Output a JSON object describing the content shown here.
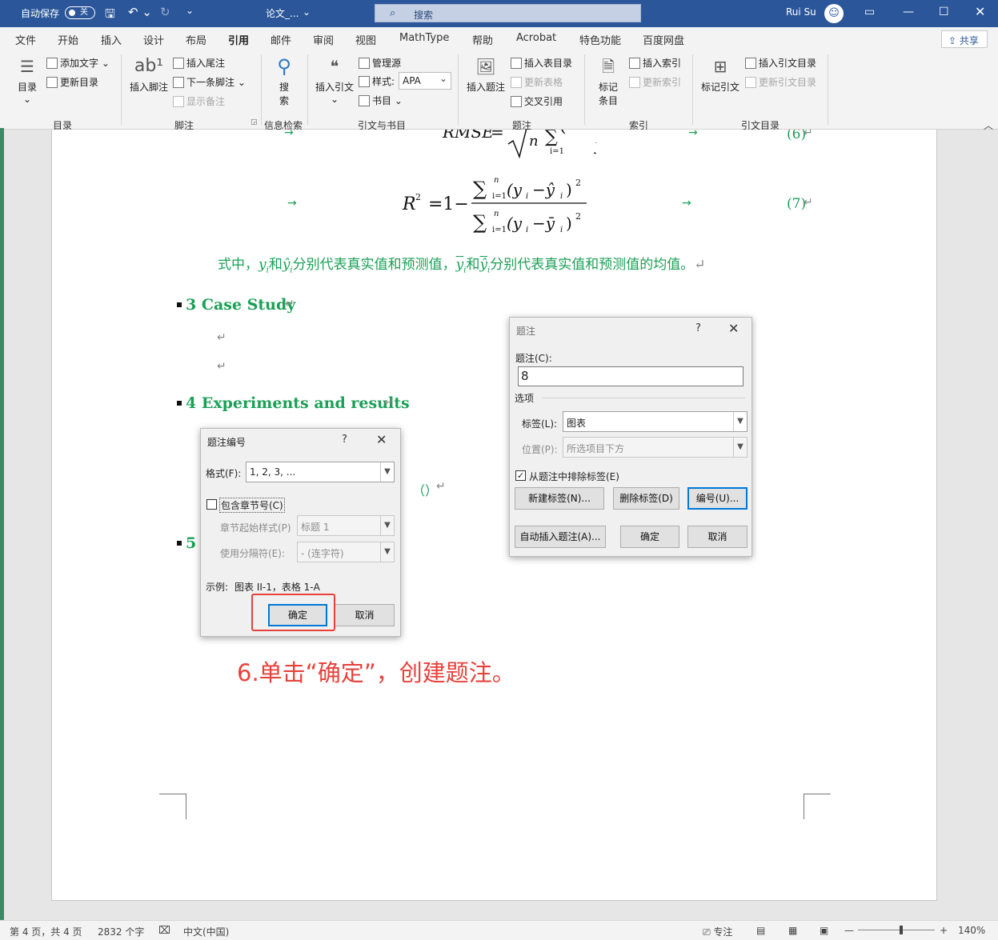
{
  "titlebar": {
    "autosave_label": "自动保存",
    "autosave_state": "关",
    "doc_title": "论文_...",
    "search_placeholder": "搜索",
    "user_name": "Rui Su"
  },
  "tabs": [
    "文件",
    "开始",
    "插入",
    "设计",
    "布局",
    "引用",
    "邮件",
    "审阅",
    "视图",
    "MathType",
    "帮助",
    "Acrobat",
    "特色功能",
    "百度网盘"
  ],
  "active_tab": "引用",
  "share_label": "共享",
  "ribbon": {
    "toc_group": "目录",
    "toc_btn": "目录",
    "add_text": "添加文字",
    "update_toc": "更新目录",
    "footnote_group": "脚注",
    "insert_footnote": "插入脚注",
    "insert_endnote": "插入尾注",
    "next_footnote": "下一条脚注",
    "show_notes": "显示备注",
    "research_group": "信息检索",
    "search_btn": "搜索",
    "citation_group": "引文与书目",
    "insert_citation": "插入引文",
    "manage_sources": "管理源",
    "style_label": "样式:",
    "style_value": "APA",
    "bibliography": "书目",
    "caption_group": "题注",
    "insert_caption": "插入题注",
    "insert_table_of_figures": "插入表目录",
    "update_table": "更新表格",
    "cross_reference": "交叉引用",
    "index_group": "索引",
    "mark_entry": "标记条目",
    "insert_index": "插入索引",
    "update_index": "更新索引",
    "toa_group": "引文目录",
    "mark_citation": "标记引文",
    "insert_toa": "插入引文目录",
    "update_toa": "更新引文目录"
  },
  "document": {
    "eq6_number": "(6)",
    "eq7_number": "(7)",
    "sentence": {
      "prefix": "式中，",
      "y": "y",
      "sub_i": "i",
      "and": "和",
      "yhat": "ŷ",
      "mid": "分别代表真实值和预测值，",
      "ybar": "y",
      "and2": "和",
      "yhatbar": "ŷ",
      "suffix": "分别代表真实值和预测值的均值。"
    },
    "heading3": "3 Case Study",
    "heading4": "4 Experiments and results",
    "heading5_partial": "5",
    "fig_number_placeholder": "（）"
  },
  "caption_dialog": {
    "title": "题注",
    "help": "?",
    "caption_label": "题注(C):",
    "caption_value": "8",
    "options_label": "选项",
    "label_label": "标签(L):",
    "label_value": "图表",
    "position_label": "位置(P):",
    "position_value": "所选项目下方",
    "exclude_label": "从题注中排除标签(E)",
    "new_label_btn": "新建标签(N)...",
    "delete_label_btn": "删除标签(D)",
    "numbering_btn": "编号(U)...",
    "autocaption_btn": "自动插入题注(A)...",
    "ok_btn": "确定",
    "cancel_btn": "取消"
  },
  "numbering_dialog": {
    "title": "题注编号",
    "help": "?",
    "format_label": "格式(F):",
    "format_value": "1, 2, 3, ...",
    "include_chapter_label": "包含章节号(C)",
    "chapter_style_label": "章节起始样式(P)",
    "chapter_style_value": "标题 1",
    "separator_label": "使用分隔符(E):",
    "separator_value": "-    (连字符)",
    "example_label": "示例:",
    "example_value": "图表 II-1，表格 1-A",
    "ok_btn": "确定",
    "cancel_btn": "取消"
  },
  "annotation": "6.单击“确定”，创建题注。",
  "statusbar": {
    "page": "第 4 页，共 4 页",
    "words": "2832 个字",
    "lang": "中文(中国)",
    "focus": "专注",
    "zoom": "140%"
  }
}
